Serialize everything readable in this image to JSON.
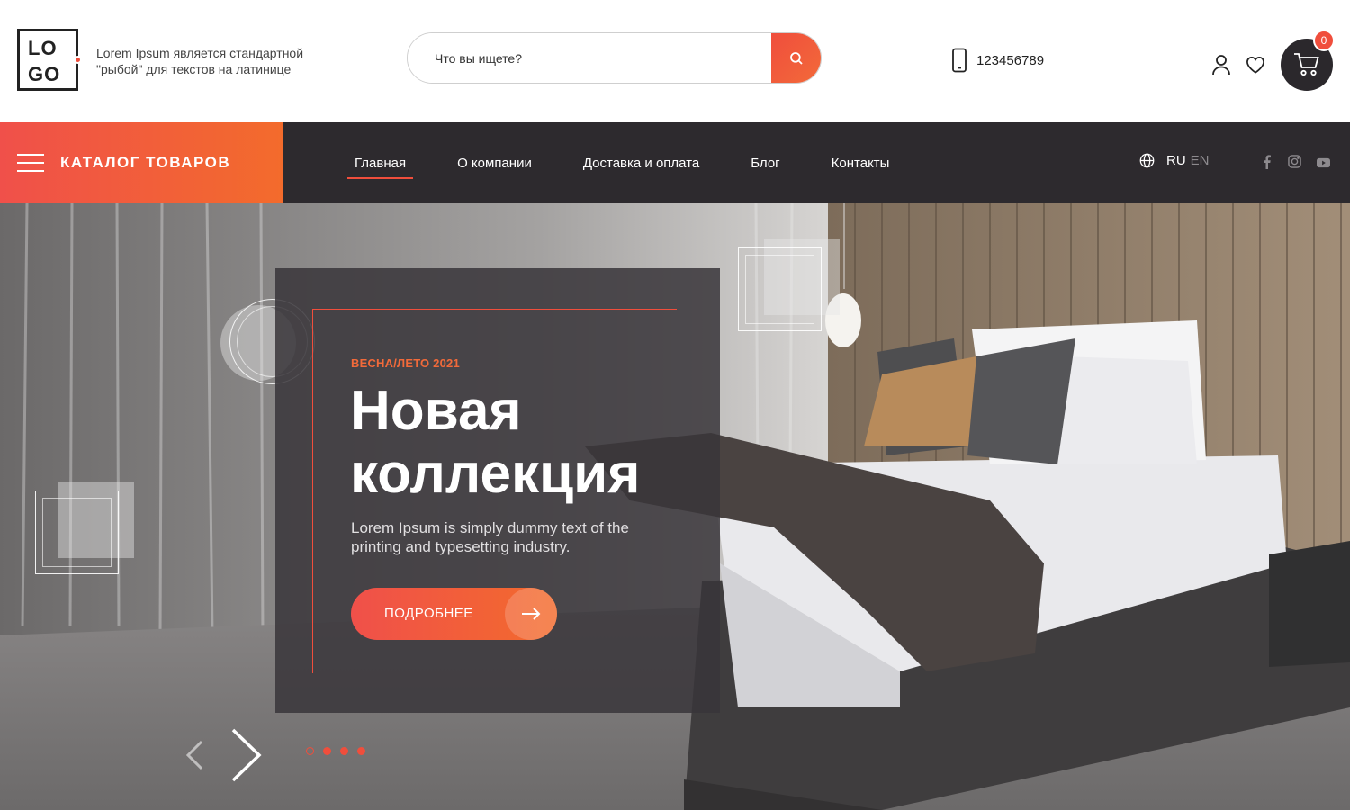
{
  "header": {
    "logo": {
      "line1": "LO",
      "line2": "GO"
    },
    "tagline": "Lorem Ipsum является стандартной \"рыбой\" для текстов на латинице",
    "search": {
      "placeholder": "Что вы ищете?",
      "icon": "search-icon"
    },
    "phone": {
      "number": "123456789",
      "icon": "mobile-phone-icon"
    },
    "account_icon": "user-icon",
    "wishlist_icon": "heart-icon",
    "cart": {
      "icon": "cart-icon",
      "count": "0"
    }
  },
  "nav": {
    "catalog_label": "КАТАЛОГ ТОВАРОВ",
    "items": [
      {
        "label": "Главная",
        "active": true
      },
      {
        "label": "О компании",
        "active": false
      },
      {
        "label": "Доставка и оплата",
        "active": false
      },
      {
        "label": "Блог",
        "active": false
      },
      {
        "label": "Контакты",
        "active": false
      }
    ],
    "lang": {
      "current": "RU",
      "other": "EN",
      "icon": "globe-icon"
    },
    "social": [
      "facebook-icon",
      "instagram-icon",
      "youtube-icon"
    ]
  },
  "hero": {
    "season": "ВЕСНА/ЛЕТО 2021",
    "title_line1": "Новая",
    "title_line2": "коллекция",
    "subtitle": "Lorem Ipsum is simply dummy text of the printing and typesetting industry.",
    "button_label": "ПОДРОБНЕЕ",
    "slides_total": 4,
    "slide_active": 1
  },
  "colors": {
    "accent": "#f04e3c",
    "accent2": "#f36b2c",
    "dark": "#2d2a2e"
  }
}
